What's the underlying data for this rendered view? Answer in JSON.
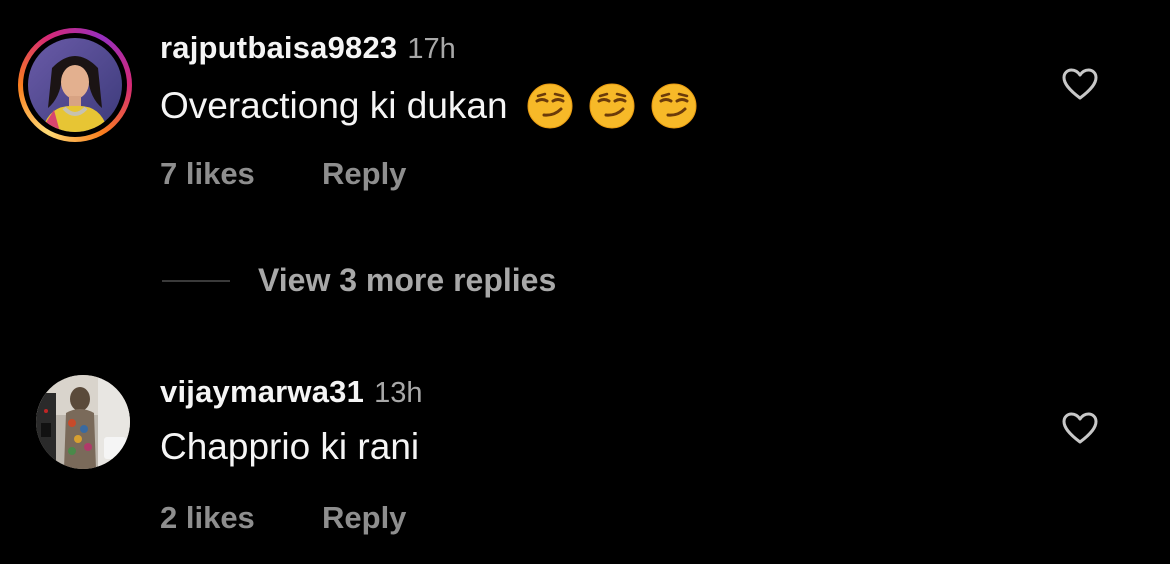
{
  "comments": [
    {
      "username": "rajputbaisa9823",
      "time": "17h",
      "text": "Overactiong ki dukan",
      "emoji": [
        "smirking-face",
        "smirking-face",
        "smirking-face"
      ],
      "likes": "7 likes",
      "reply_label": "Reply",
      "has_story": true
    },
    {
      "username": "vijaymarwa31",
      "time": "13h",
      "text": "Chapprio ki rani",
      "likes": "2 likes",
      "reply_label": "Reply",
      "has_story": false
    }
  ],
  "view_replies": {
    "label": "View 3 more replies"
  },
  "icons": {
    "like": "heart-outline-icon"
  },
  "colors": {
    "background": "#000000",
    "primary_text": "#f5f5f5",
    "secondary_text": "#a8a8a8",
    "action_text": "#8e8e8e"
  }
}
